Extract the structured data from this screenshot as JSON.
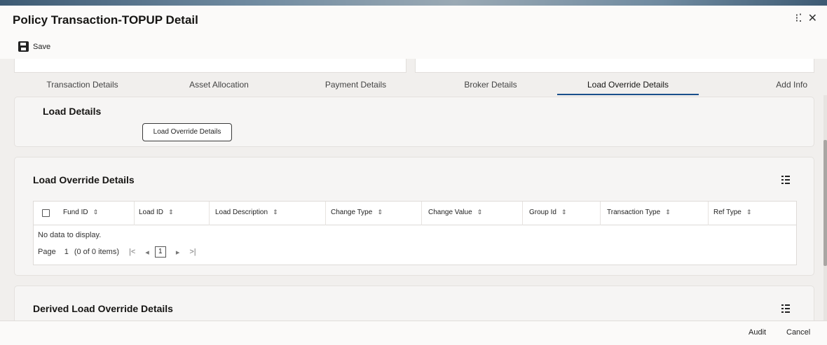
{
  "window": {
    "title": "Policy Transaction-TOPUP Detail",
    "restore_glyph": "⁝⁚",
    "close_glyph": "✕"
  },
  "toolbar": {
    "save_label": "Save",
    "save_icon": "floppy-disk-icon"
  },
  "tabs": [
    {
      "label": "Transaction Details",
      "active": false
    },
    {
      "label": "Asset Allocation",
      "active": false
    },
    {
      "label": "Payment Details",
      "active": false
    },
    {
      "label": "Broker Details",
      "active": false
    },
    {
      "label": "Load Override Details",
      "active": true
    },
    {
      "label": "Add Info",
      "active": false
    }
  ],
  "load_details": {
    "title": "Load Details",
    "button_label": "Load Override Details"
  },
  "load_override": {
    "title": "Load Override Details",
    "columns": [
      "Fund ID",
      "Load ID",
      "Load Description",
      "Change Type",
      "Change Value",
      "Group Id",
      "Transaction Type",
      "Ref Type"
    ],
    "sort_glyph": "⇕",
    "empty_text": "No data to display.",
    "pager": {
      "page_label": "Page",
      "page_number": "1",
      "items_info": "(0 of 0 items)",
      "first": "|<",
      "prev": "◂",
      "current": "1",
      "next": "▸",
      "last": ">|"
    }
  },
  "derived_override": {
    "title": "Derived Load Override Details"
  },
  "footer": {
    "audit_label": "Audit",
    "cancel_label": "Cancel"
  },
  "colors": {
    "accent": "#1a4f8b",
    "card_bg": "#f6f5f4",
    "page_bg": "#f1efed"
  }
}
